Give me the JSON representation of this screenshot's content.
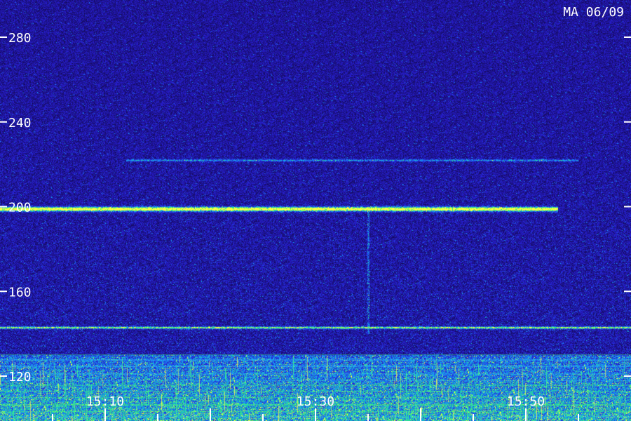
{
  "chart_data": {
    "type": "heatmap",
    "stamp": "MA 06/09",
    "y_ticks": [
      {
        "value": 280,
        "label": "280"
      },
      {
        "value": 240,
        "label": "240"
      },
      {
        "value": 200,
        "label": "200"
      },
      {
        "value": 160,
        "label": "160"
      },
      {
        "value": 120,
        "label": "120"
      }
    ],
    "x_ticks": [
      {
        "value": "15:10",
        "label": "15:10"
      },
      {
        "value": "15:30",
        "label": "15:30"
      },
      {
        "value": "15:50",
        "label": "15:50"
      }
    ],
    "x_range": [
      "15:00",
      "16:00"
    ],
    "y_range": [
      100,
      296
    ],
    "colors": {
      "background": "#1a0f72",
      "low": "#3a2fe0",
      "mid": "#2aa0ff",
      "high": "#3cff6a",
      "peak": "#ffff40",
      "ticks": "#ffffff"
    },
    "features": [
      {
        "kind": "horizontal-band",
        "freq": 199,
        "intensity": "high",
        "start": "15:00",
        "end": "15:53"
      },
      {
        "kind": "horizontal-band",
        "freq": 143,
        "intensity": "medium",
        "start": "15:00",
        "end": "16:00"
      },
      {
        "kind": "horizontal-band",
        "freq": 222,
        "intensity": "low",
        "start": "15:12",
        "end": "15:55"
      },
      {
        "kind": "vertical-line",
        "time": "15:35",
        "freq_from": 140,
        "freq_to": 200
      },
      {
        "kind": "dense-noise-floor",
        "freq_from": 100,
        "freq_to": 130
      }
    ]
  }
}
